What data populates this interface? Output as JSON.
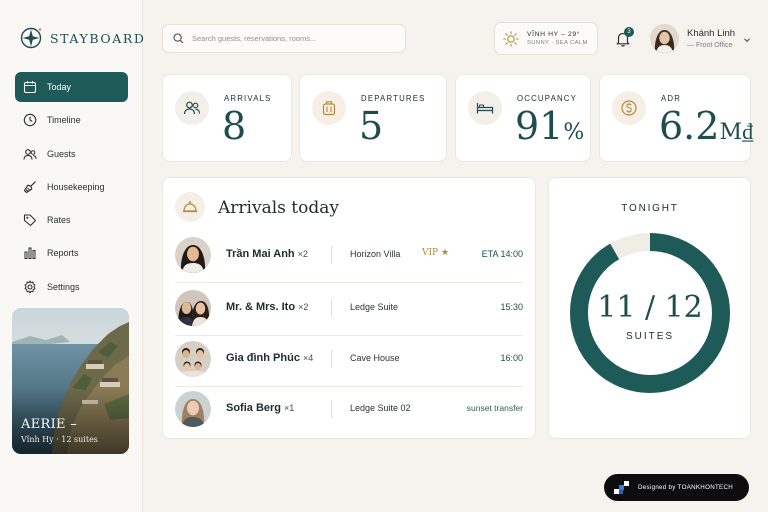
{
  "brand": {
    "name": "STAYBOARD"
  },
  "sidebar": {
    "items": [
      {
        "label": "Today",
        "icon": "calendar-icon",
        "active": true
      },
      {
        "label": "Timeline",
        "icon": "clock-icon"
      },
      {
        "label": "Guests",
        "icon": "users-icon"
      },
      {
        "label": "Housekeeping",
        "icon": "broom-icon"
      },
      {
        "label": "Rates",
        "icon": "tag-icon"
      },
      {
        "label": "Reports",
        "icon": "bar-chart-icon"
      },
      {
        "label": "Settings",
        "icon": "gear-icon"
      }
    ],
    "promo": {
      "title": "AERIE –",
      "subtitle": "Vĩnh Hy · 12 suites"
    }
  },
  "header": {
    "search_placeholder": "Search guests, reservations, rooms...",
    "weather": {
      "line1": "VĨNH HY – 29°",
      "line2": "SUNNY · SEA CALM"
    },
    "notifications": "3",
    "user": {
      "name": "Khánh Linh",
      "role": "— Front Office"
    }
  },
  "stats": [
    {
      "label": "ARRIVALS",
      "value": "8",
      "unit": "",
      "icon": "guests-icon"
    },
    {
      "label": "DEPARTURES",
      "value": "5",
      "unit": "",
      "icon": "luggage-icon"
    },
    {
      "label": "OCCUPANCY",
      "value": "91",
      "unit": "%",
      "icon": "bed-icon"
    },
    {
      "label": "ADR",
      "value": "6.2",
      "unit": "M₫",
      "icon": "coin-icon"
    }
  ],
  "arrivals": {
    "title": "Arrivals today",
    "rows": [
      {
        "guest": "Trần Mai Anh",
        "count": "×2",
        "room": "Horizon Villa",
        "vip": "VIP ★",
        "eta": "ETA 14:00"
      },
      {
        "guest": "Mr. & Mrs. Ito",
        "count": "×2",
        "room": "Ledge Suite",
        "vip": "",
        "eta": "15:30"
      },
      {
        "guest": "Gia đình Phúc",
        "count": "×4",
        "room": "Cave House",
        "vip": "",
        "eta": "16:00"
      },
      {
        "guest": "Sofia Berg",
        "count": "×1",
        "room": "Ledge Suite 02",
        "vip": "",
        "eta": "sunset transfer"
      }
    ]
  },
  "tonight": {
    "label": "TONIGHT",
    "value": "11 / 12",
    "unit": "SUITES",
    "occupied": 11,
    "total": 12
  },
  "credit": "Designed by TOANKHONTECH",
  "colors": {
    "accent": "#1d5a58",
    "gold": "#b38a3b",
    "background": "#f6f3ee"
  }
}
